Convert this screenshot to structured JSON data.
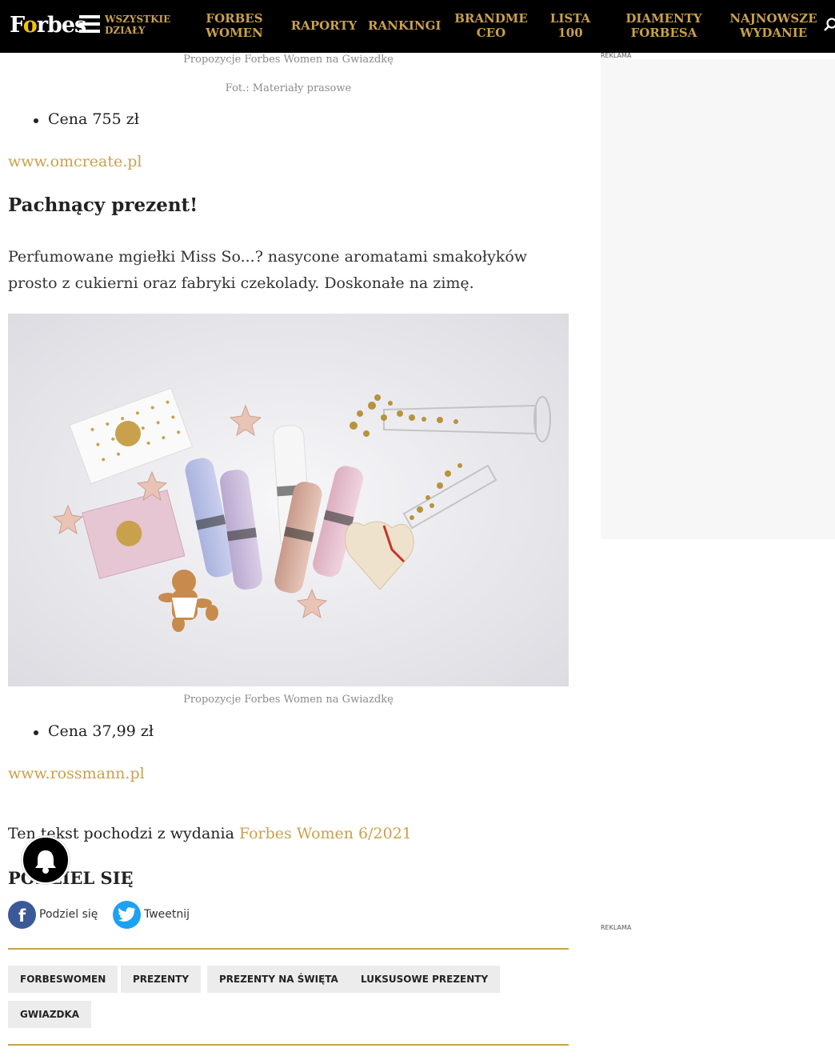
{
  "header": {
    "logo": "Forbes",
    "all_sections": "WSZYSTKIE DZIAŁY",
    "nav": [
      "FORBES WOMEN",
      "RAPORTY",
      "RANKINGI",
      "BRANDME CEO",
      "LISTA 100",
      "DIAMENTY FORBESA",
      "NAJNOWSZE WYDANIE"
    ],
    "accent_color": "#c9a14d"
  },
  "article": {
    "caption_top": "Propozycje Forbes Women na Gwiazdkę",
    "photo_credit": "Fot.: Materiały prasowe",
    "price_1": "Cena 755 zł",
    "link_1": "www.omcreate.pl",
    "subheading": "Pachnący prezent!",
    "paragraph": "Perfumowane mgiełki Miss So...? nasycone aromatami smakołyków prosto z cukierni oraz fabryki czekolady. Doskonałe na zimę.",
    "caption_2": "Propozycje Forbes Women na Gwiazdkę",
    "price_2": "Cena 37,99 zł",
    "link_2": "www.rossmann.pl",
    "source_text": "Ten tekst pochodzi z wydania ",
    "source_link": "Forbes Women 6/2021"
  },
  "share": {
    "title": "PODZIEL SIĘ",
    "facebook": "Podziel się",
    "twitter": "Tweetnij"
  },
  "tags": [
    "FORBESWOMEN",
    "PREZENTY",
    "PREZENTY NA ŚWIĘTA",
    "LUKSUSOWE PREZENTY",
    "GWIAZDKA"
  ],
  "ads": {
    "label_1": "REKLAMA",
    "label_2": "REKLAMA"
  },
  "icons": [
    "menu-icon",
    "search-icon",
    "bell-icon",
    "facebook-icon",
    "twitter-icon"
  ]
}
